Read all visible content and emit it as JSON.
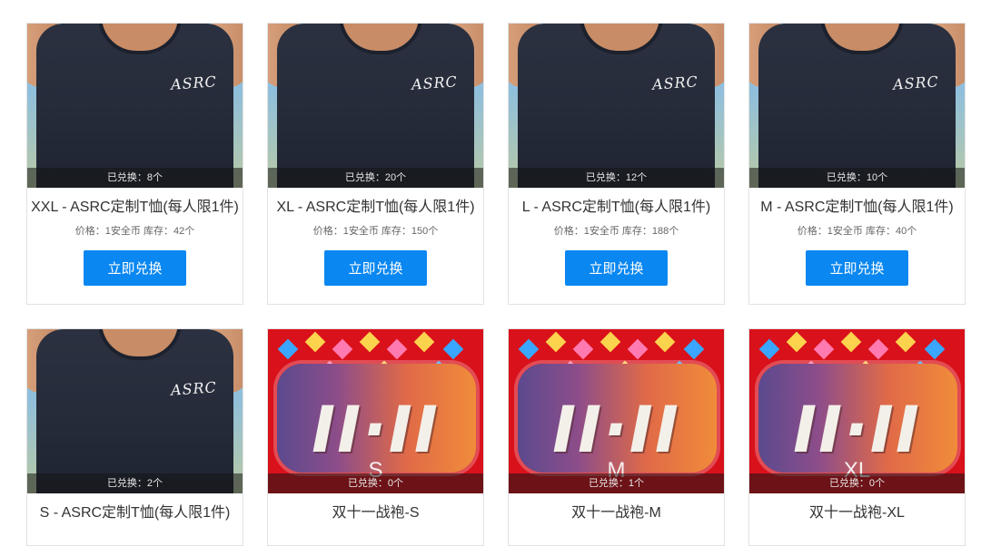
{
  "products": [
    {
      "title": "XXL - ASRC定制T恤(每人限1件)",
      "exchanged": "已兑换：8个",
      "meta": "价格：1安全币 库存：42个",
      "button": "立即兑换",
      "image": "tshirt-photo",
      "logo_text": "ASRC"
    },
    {
      "title": "XL - ASRC定制T恤(每人限1件)",
      "exchanged": "已兑换：20个",
      "meta": "价格：1安全币 库存：150个",
      "button": "立即兑换",
      "image": "tshirt-photo",
      "logo_text": "ASRC"
    },
    {
      "title": "L - ASRC定制T恤(每人限1件)",
      "exchanged": "已兑换：12个",
      "meta": "价格：1安全币 库存：188个",
      "button": "立即兑换",
      "image": "tshirt-photo",
      "logo_text": "ASRC"
    },
    {
      "title": "M - ASRC定制T恤(每人限1件)",
      "exchanged": "已兑换：10个",
      "meta": "价格：1安全币 库存：40个",
      "button": "立即兑换",
      "image": "tshirt-photo",
      "logo_text": "ASRC"
    },
    {
      "title": "S - ASRC定制T恤(每人限1件)",
      "exchanged": "已兑换：2个",
      "image": "tshirt-photo",
      "logo_text": "ASRC"
    },
    {
      "title": "双十一战袍-S",
      "exchanged": "已兑换：0个",
      "image": "promo-1111",
      "promo_text": "II·II",
      "size_text": "S"
    },
    {
      "title": "双十一战袍-M",
      "exchanged": "已兑换：1个",
      "image": "promo-1111",
      "promo_text": "II·II",
      "size_text": "M"
    },
    {
      "title": "双十一战袍-XL",
      "exchanged": "已兑换：0个",
      "image": "promo-1111",
      "promo_text": "II·II",
      "size_text": "XL"
    }
  ],
  "colors": {
    "button": "#0a87f0",
    "promo_bg": "#d9111b",
    "shirt": "#252b39"
  }
}
